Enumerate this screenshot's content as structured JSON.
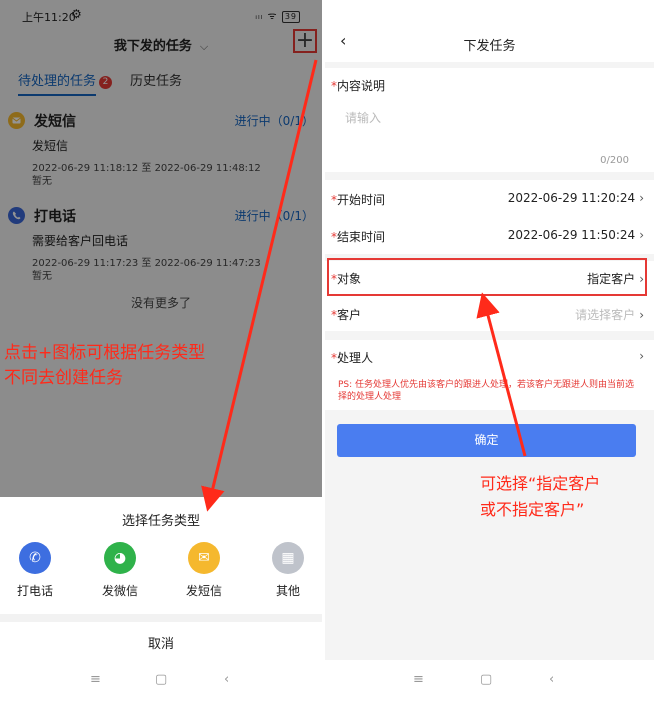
{
  "left": {
    "status": {
      "time": "上午11:20",
      "gear": "⚙",
      "signal": "ᵢₗₗ ᯤ",
      "battery": "39"
    },
    "title": "我下发的任务",
    "title_chevron": "⌵",
    "plus_icon": "+",
    "tabs": {
      "active": "待处理的任务",
      "active_badge": "2",
      "history": "历史任务"
    },
    "tasks": [
      {
        "icon": "mail-icon",
        "icon_color": "#f5b82e",
        "name": "发短信",
        "status": "进行中（0/1）",
        "desc": "发短信",
        "time": "2022-06-29 11:18:12 至 2022-06-29 11:48:12",
        "note": "暂无"
      },
      {
        "icon": "phone-icon",
        "icon_color": "#3a66d6",
        "name": "打电话",
        "status": "进行中（0/1）",
        "desc": "需要给客户回电话",
        "time": "2022-06-29 11:17:23 至 2022-06-29 11:47:23",
        "note": "暂无"
      }
    ],
    "no_more": "没有更多了",
    "annotation": [
      "点击+图标可根据任务类型",
      "不同去创建任务"
    ],
    "sheet": {
      "title": "选择任务类型",
      "options": [
        {
          "label": "打电话",
          "icon": "phone-icon",
          "glyph": "✆",
          "color": "#3d6ee0"
        },
        {
          "label": "发微信",
          "icon": "wechat-icon",
          "glyph": "◕",
          "color": "#2fb24a"
        },
        {
          "label": "发短信",
          "icon": "mail-icon",
          "glyph": "✉",
          "color": "#f5b82e"
        },
        {
          "label": "其他",
          "icon": "grid-icon",
          "glyph": "▦",
          "color": "#bfc3cb"
        }
      ],
      "cancel": "取消"
    },
    "nav": {
      "menu": "≡",
      "home": "▢",
      "back": "‹"
    }
  },
  "right": {
    "back": "‹",
    "title": "下发任务",
    "required_mark": "*",
    "content_label": "内容说明",
    "content_placeholder": "请输入",
    "content_counter": "0/200",
    "start_label": "开始时间",
    "start_value": "2022-06-29 11:20:24",
    "end_label": "结束时间",
    "end_value": "2022-06-29 11:50:24",
    "target_label": "对象",
    "target_value": "指定客户",
    "customer_label": "客户",
    "customer_placeholder": "请选择客户",
    "handler_label": "处理人",
    "handler_note": "PS: 任务处理人优先由该客户的跟进人处理，若该客户无跟进人则由当前选择的处理人处理",
    "chevron": "›",
    "confirm": "确定",
    "annotation": [
      "可选择“指定客户",
      "或不指定客户”"
    ],
    "nav": {
      "menu": "≡",
      "home": "▢",
      "back": "‹"
    }
  }
}
